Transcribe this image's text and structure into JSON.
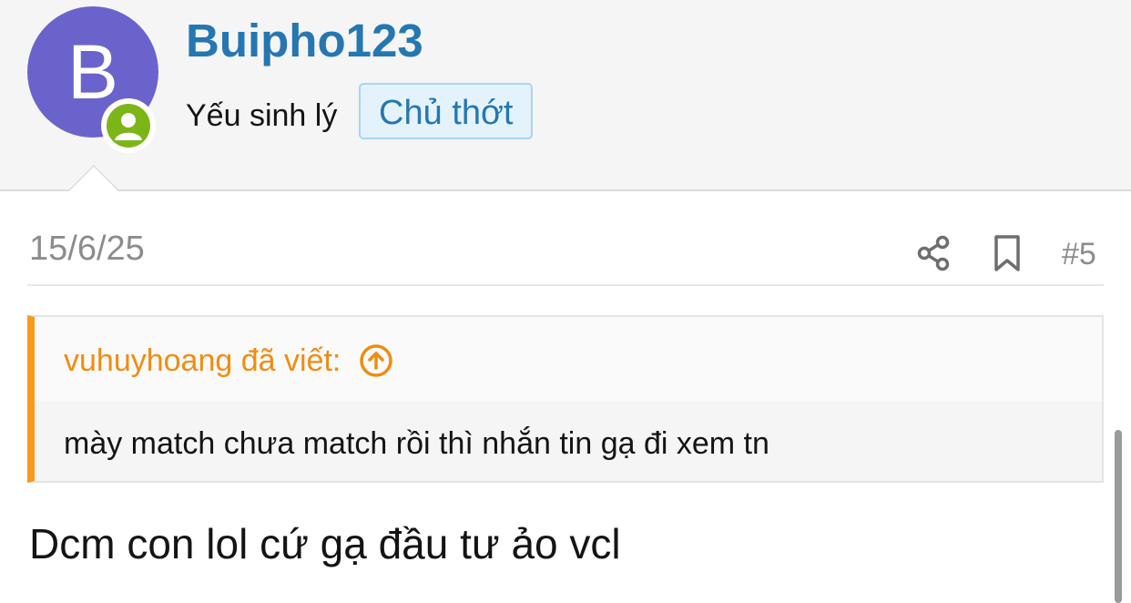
{
  "author": {
    "avatar_letter": "B",
    "username": "Buipho123",
    "user_title": "Yếu sinh lý",
    "op_badge": "Chủ thớt"
  },
  "post": {
    "date": "15/6/25",
    "number": "#5",
    "quote": {
      "attribution": "vuhuyhoang đã viết:",
      "text": "mày match chưa match rồi thì nhắn tin gạ đi xem tn"
    },
    "message": "Dcm con lol cứ gạ đầu tư ảo vcl"
  },
  "icons": {
    "online_status": "user-online-icon",
    "share": "share-icon",
    "bookmark": "bookmark-icon",
    "quote_jump": "arrow-up-circle-icon"
  },
  "colors": {
    "avatar_bg": "#6b63cc",
    "online_green": "#7cb518",
    "username_blue": "#2577b1",
    "quote_accent": "#f7991e"
  }
}
